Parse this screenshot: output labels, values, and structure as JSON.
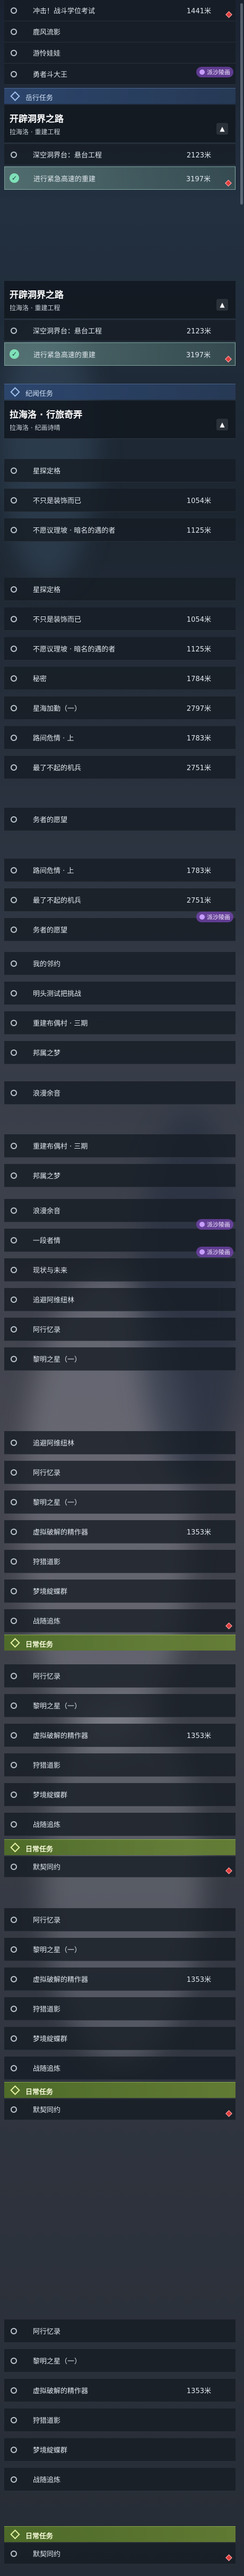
{
  "items": {
    "r1": {
      "label": "冲击！战斗学位考试",
      "value": "1441米"
    },
    "r2": {
      "label": "鹿风流影"
    },
    "r3": {
      "label": "游怜娃娃"
    },
    "r4": {
      "label": "勇者斗大王"
    },
    "r5": {
      "label": "深空洞界台：悬台工程",
      "value": "2123米"
    },
    "r6": {
      "label": "进行紧急高速的重建",
      "value": "3197米"
    },
    "r7": {
      "label": "深空洞界台：悬台工程",
      "value": "2123米"
    },
    "r8": {
      "label": "进行紧急高速的重建",
      "value": "3197米"
    },
    "r9": {
      "label": "星探定格"
    },
    "r10": {
      "label": "不只是装饰而已",
      "value": "1054米"
    },
    "r11": {
      "label": "不愿议理坡 · 暗名的遇的者",
      "value": "1125米"
    },
    "r12": {
      "label": "星探定格"
    },
    "r13": {
      "label": "不只是装饰而已",
      "value": "1054米"
    },
    "r14": {
      "label": "不愿议理坡 · 暗名的遇的者",
      "value": "1125米"
    },
    "r15": {
      "label": "秘密",
      "value": "1784米"
    },
    "r16": {
      "label": "星海加勤（一）",
      "value": "2797米"
    },
    "r17": {
      "label": "路间危情 · 上",
      "value": "1783米"
    },
    "r18": {
      "label": "最了不起的机兵",
      "value": "2751米"
    },
    "r19": {
      "label": "务者的愿望"
    },
    "r20": {
      "label": "路间危情 · 上",
      "value": "1783米"
    },
    "r21": {
      "label": "最了不起的机兵",
      "value": "2751米"
    },
    "r22": {
      "label": "务者的愿望"
    },
    "r23": {
      "label": "我的邻约"
    },
    "r24": {
      "label": "明头测试把挑战"
    },
    "r25": {
      "label": "重建布偶村 · 三期"
    },
    "r26": {
      "label": "邦属之梦"
    },
    "r27": {
      "label": "浪漫余音"
    },
    "r28": {
      "label": "重建布偶村 · 三期"
    },
    "r29": {
      "label": "邦属之梦"
    },
    "r30": {
      "label": "浪漫余音"
    },
    "r31": {
      "label": "一段者情"
    },
    "r32": {
      "label": "现状与未来"
    },
    "r33": {
      "label": "追避阿维纽林"
    },
    "r34": {
      "label": "阿行忆录"
    },
    "r35": {
      "label": "黎明之星（一）"
    },
    "r36": {
      "label": "追避阿维纽林"
    },
    "r37": {
      "label": "阿行忆录"
    },
    "r38": {
      "label": "黎明之星（一）"
    },
    "r39": {
      "label": "虚拟破解的精作器",
      "value": "1353米"
    },
    "r40": {
      "label": "狩猎道影"
    },
    "r41": {
      "label": "梦境綻蝶群"
    },
    "r42": {
      "label": "战随追炼"
    },
    "r43": {
      "label": "阿行忆录"
    },
    "r44": {
      "label": "黎明之星（一）"
    },
    "r45": {
      "label": "虚拟破解的精作器",
      "value": "1353米"
    },
    "r46": {
      "label": "狩猎道影"
    },
    "r47": {
      "label": "梦境綻蝶群"
    },
    "r48": {
      "label": "战随追炼"
    },
    "r49": {
      "label": "默契同约"
    },
    "r50": {
      "label": "阿行忆录"
    },
    "r51": {
      "label": "黎明之星（一）"
    },
    "r52": {
      "label": "虚拟破解的精作器",
      "value": "1353米"
    },
    "r53": {
      "label": "狩猎道影"
    },
    "r54": {
      "label": "梦境綻蝶群"
    },
    "r55": {
      "label": "战随追炼"
    },
    "r56": {
      "label": "默契同约"
    },
    "r57": {
      "label": "阿行忆录"
    },
    "r58": {
      "label": "黎明之星（一）"
    },
    "r59": {
      "label": "虚拟破解的精作器",
      "value": "1353米"
    },
    "r60": {
      "label": "狩猎道影"
    },
    "r61": {
      "label": "梦境綻蝶群"
    },
    "r62": {
      "label": "战随追炼"
    },
    "r63": {
      "label": "默契同约"
    }
  },
  "quests": {
    "q1": {
      "title": "开辟洞界之路",
      "subtitle": "拉海洛 · 重建工程"
    },
    "q2": {
      "title": "开辟洞界之路",
      "subtitle": "拉海洛 · 重建工程"
    },
    "q3": {
      "title": "拉海洛 · 行旅奇弄",
      "subtitle": "拉海洛 · 纪画诗晴"
    }
  },
  "sections": {
    "companion": "岳行任务",
    "discovery": "纪闻任务",
    "daily": "日常任务"
  },
  "watermark": "派沙陵画",
  "colors": {
    "flag": "#e03c3c",
    "check": "#7fe0b8",
    "daily": "#6e8c32",
    "section": "#2c466e"
  },
  "icons": {
    "check": "check-icon",
    "collapse": "chevron-up-icon",
    "section": "diamond-icon",
    "flag": "red-diamond-icon"
  }
}
